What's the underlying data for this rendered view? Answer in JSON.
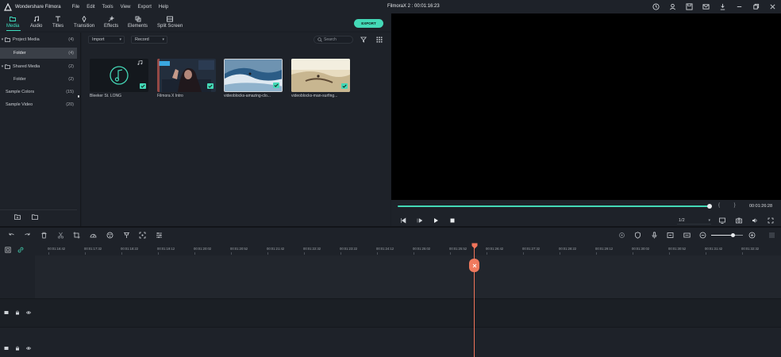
{
  "app": {
    "name": "Wondershare Filmora",
    "project_title": "FilmoraX 2 : 00:01:16:23",
    "menu": [
      "File",
      "Edit",
      "Tools",
      "View",
      "Export",
      "Help"
    ]
  },
  "tabs": [
    "Media",
    "Audio",
    "Titles",
    "Transition",
    "Effects",
    "Elements",
    "Split Screen"
  ],
  "export_label": "EXPORT",
  "library": {
    "items": [
      {
        "label": "Project Media",
        "count": "(4)"
      },
      {
        "label": "Folder",
        "count": "(4)"
      },
      {
        "label": "Shared Media",
        "count": "(2)"
      },
      {
        "label": "Folder",
        "count": "(2)"
      },
      {
        "label": "Sample Colors",
        "count": "(15)"
      },
      {
        "label": "Sample Video",
        "count": "(20)"
      }
    ]
  },
  "media_toolbar": {
    "import_label": "Import",
    "record_label": "Record",
    "search_placeholder": "Search"
  },
  "media_items": [
    {
      "label": "Bleeker St. LONG",
      "kind": "audio"
    },
    {
      "label": "Filmora X Intro",
      "kind": "video"
    },
    {
      "label": "videoblocks-amazing-clo...",
      "kind": "video"
    },
    {
      "label": "videoblocks-man-surfing...",
      "kind": "video"
    }
  ],
  "preview": {
    "timecode": "00:01:26:28",
    "ratio": "1/2",
    "progress": 0.99,
    "brackets": "{ }"
  },
  "timeline": {
    "zoom_level": 0.66,
    "ruler": [
      "00:01:16:42",
      "00:01:17:32",
      "00:01:18:22",
      "00:01:19:12",
      "00:01:20:02",
      "00:01:20:52",
      "00:01:21:42",
      "00:01:22:32",
      "00:01:23:22",
      "00:01:24:12",
      "00:01:25:02",
      "00:01:25:52",
      "00:01:26:42",
      "00:01:27:32",
      "00:01:28:22",
      "00:01:29:12",
      "00:01:30:02",
      "00:01:30:52",
      "00:01:31:42",
      "00:01:32:32"
    ]
  },
  "colors": {
    "accent": "#44d9b7",
    "playhead": "#f0745a",
    "panel": "#1e2229",
    "preview_bg": "#000000"
  },
  "icons": {
    "window": [
      "clock-icon",
      "user-icon",
      "save-icon",
      "mail-icon",
      "download-icon",
      "minimize-icon",
      "restore-icon",
      "close-icon"
    ],
    "tabs": [
      "folder-icon",
      "music-note-icon",
      "text-t-icon",
      "transition-icon",
      "effects-icon",
      "elements-icon",
      "split-screen-icon"
    ]
  }
}
